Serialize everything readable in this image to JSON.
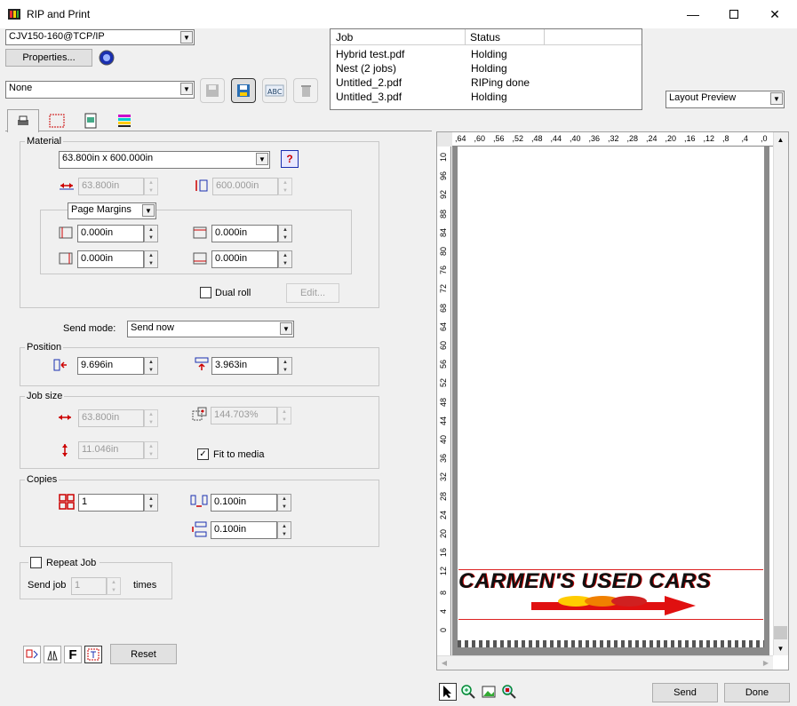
{
  "window": {
    "title": "RIP and Print"
  },
  "printer": {
    "selected": "CJV150-160@TCP/IP",
    "properties_label": "Properties..."
  },
  "preset": {
    "selected": "None"
  },
  "jobs": {
    "headers": [
      "Job",
      "Status"
    ],
    "rows": [
      {
        "job": "Hybrid test.pdf",
        "status": "Holding"
      },
      {
        "job": "Nest (2 jobs)",
        "status": "Holding"
      },
      {
        "job": "Untitled_2.pdf",
        "status": "RIPing done"
      },
      {
        "job": "Untitled_3.pdf",
        "status": "Holding"
      }
    ]
  },
  "view_mode": {
    "selected": "Layout Preview"
  },
  "material": {
    "title": "Material",
    "size": "63.800in x 600.000in",
    "width": "63.800in",
    "height": "600.000in",
    "margins_mode": "Page Margins",
    "margin_left": "0.000in",
    "margin_top": "0.000in",
    "margin_right": "0.000in",
    "margin_bottom": "0.000in",
    "dual_roll_label": "Dual roll",
    "edit_label": "Edit..."
  },
  "send_mode": {
    "label": "Send mode:",
    "selected": "Send now"
  },
  "position": {
    "title": "Position",
    "x": "9.696in",
    "y": "3.963in"
  },
  "job_size": {
    "title": "Job size",
    "width": "63.800in",
    "height": "11.046in",
    "scale": "144.703%",
    "fit_label": "Fit to media",
    "fit_checked": "✓"
  },
  "copies": {
    "title": "Copies",
    "count": "1",
    "h_gap": "0.100in",
    "v_gap": "0.100in"
  },
  "repeat": {
    "title": "Repeat Job",
    "send_job_label": "Send job",
    "send_job_value": "1",
    "times_label": "times"
  },
  "bottom": {
    "reset_label": "Reset",
    "f_label": "F",
    "send_label": "Send",
    "done_label": "Done"
  },
  "preview": {
    "top_ruler": [
      ",64",
      ",60",
      ",56",
      ",52",
      ",48",
      ",44",
      ",40",
      ",36",
      ",32",
      ",28",
      ",24",
      ",20",
      ",16",
      ",12",
      ",8",
      ",4",
      ",0"
    ],
    "left_ruler": [
      "10",
      "96",
      "92",
      "88",
      "84",
      "80",
      "76",
      "72",
      "68",
      "64",
      "60",
      "56",
      "52",
      "48",
      "44",
      "40",
      "36",
      "32",
      "28",
      "24",
      "20",
      "16",
      "12",
      "8",
      "4",
      "0"
    ],
    "logo_text": "CARMEN'S USED CARS"
  },
  "colors": {
    "accent": "#0078d7",
    "icon_blue": "#1a2fb0",
    "icon_red": "#d01010"
  }
}
